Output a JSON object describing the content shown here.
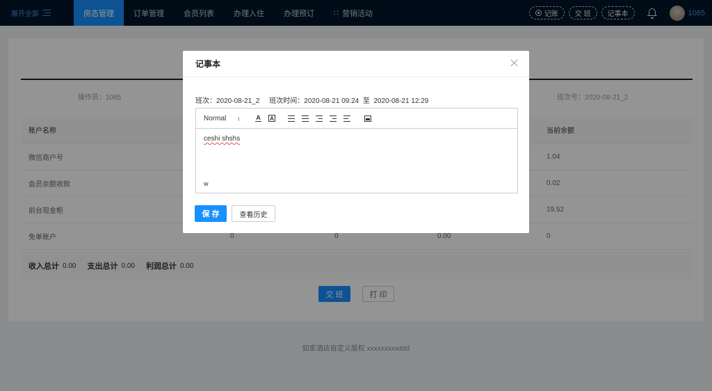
{
  "nav": {
    "expand_label": "展开全部",
    "items": [
      "房态管理",
      "订单管理",
      "会员列表",
      "办理入住",
      "办理预订",
      "营销活动"
    ],
    "active_index": 0,
    "pills": [
      "记账",
      "交 班",
      "记事本"
    ],
    "user_name": "1065"
  },
  "shift": {
    "operator": "操作员：1065",
    "shift_no": "班次号：2020-08-21_2"
  },
  "table": {
    "headers": [
      "账户名称",
      "",
      "",
      "",
      "当前余额"
    ],
    "rows": [
      [
        "微信商户号",
        "",
        "",
        "",
        "1.04"
      ],
      [
        "会员余额收款",
        "",
        "",
        "",
        "0.02"
      ],
      [
        "前台现金柜",
        "",
        "",
        "",
        "19.52"
      ],
      [
        "免单账户",
        "0",
        "0",
        "0.00",
        "0"
      ]
    ]
  },
  "totals": {
    "income_label": "收入总计",
    "income_value": "0.00",
    "expense_label": "支出总计",
    "expense_value": "0.00",
    "profit_label": "利润总计",
    "profit_value": "0.00"
  },
  "actions": {
    "handover": "交 班",
    "print": "打 印"
  },
  "footer": "如家酒店自定义版权 xxxxxxxxxddd",
  "modal": {
    "title": "记事本",
    "shift_label": "班次：2020-08-21_2",
    "shift_time": "班次时间：2020-08-21 09:24",
    "to": "至",
    "shift_end": "2020-08-21 12:29",
    "toolbar_format": "Normal",
    "content_line1": "ceshi shshs",
    "content_line2": "w",
    "save": "保 存",
    "history": "查看历史"
  },
  "colors": {
    "nav_bg": "#001529",
    "accent": "#1890ff"
  }
}
